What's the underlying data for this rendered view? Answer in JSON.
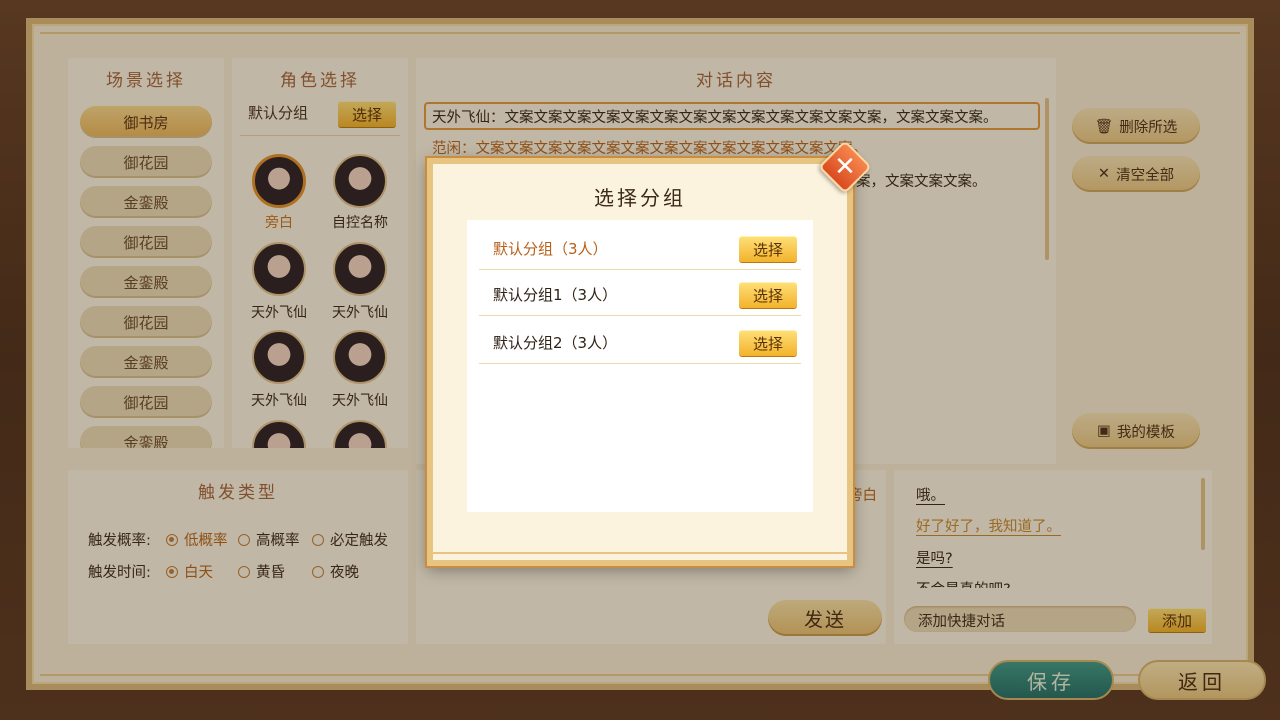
{
  "scene": {
    "title": "场景选择",
    "items": [
      "御书房",
      "御花园",
      "金銮殿",
      "御花园",
      "金銮殿",
      "御花园",
      "金銮殿",
      "御花园",
      "金銮殿"
    ]
  },
  "role": {
    "title": "角色选择",
    "group_name": "默认分组",
    "select_label": "选择",
    "roles": [
      "旁白",
      "自控名称",
      "天外飞仙",
      "天外飞仙",
      "天外飞仙",
      "天外飞仙"
    ]
  },
  "dialog": {
    "title": "对话内容",
    "lines": [
      "天外飞仙：文案文案文案文案文案文案文案文案文案文案文案文案文案，文案文案文案。",
      "范闲：文案文案文案文案文案文案文案文案文案文案文案文案文案。",
      "案，文案文案文案。"
    ],
    "delete_selected": "删除所选",
    "clear_all": "清空全部",
    "my_template": "我的模板"
  },
  "trigger": {
    "title": "触发类型",
    "prob_label": "触发概率:",
    "prob_options": [
      "低概率",
      "高概率",
      "必定触发"
    ],
    "time_label": "触发时间:",
    "time_options": [
      "白天",
      "黄昏",
      "夜晚"
    ]
  },
  "send": {
    "speaker": "旁白",
    "send_label": "发送"
  },
  "quick": {
    "items": [
      "哦。",
      "好了好了，我知道了。",
      "是吗?",
      "不会是真的吧?"
    ],
    "add_placeholder": "添加快捷对话",
    "add_label": "添加"
  },
  "footer": {
    "save": "保存",
    "back": "返回"
  },
  "modal": {
    "title": "选择分组",
    "groups": [
      "默认分组（3人）",
      "默认分组1（3人）",
      "默认分组2（3人）"
    ],
    "select_label": "选择"
  }
}
